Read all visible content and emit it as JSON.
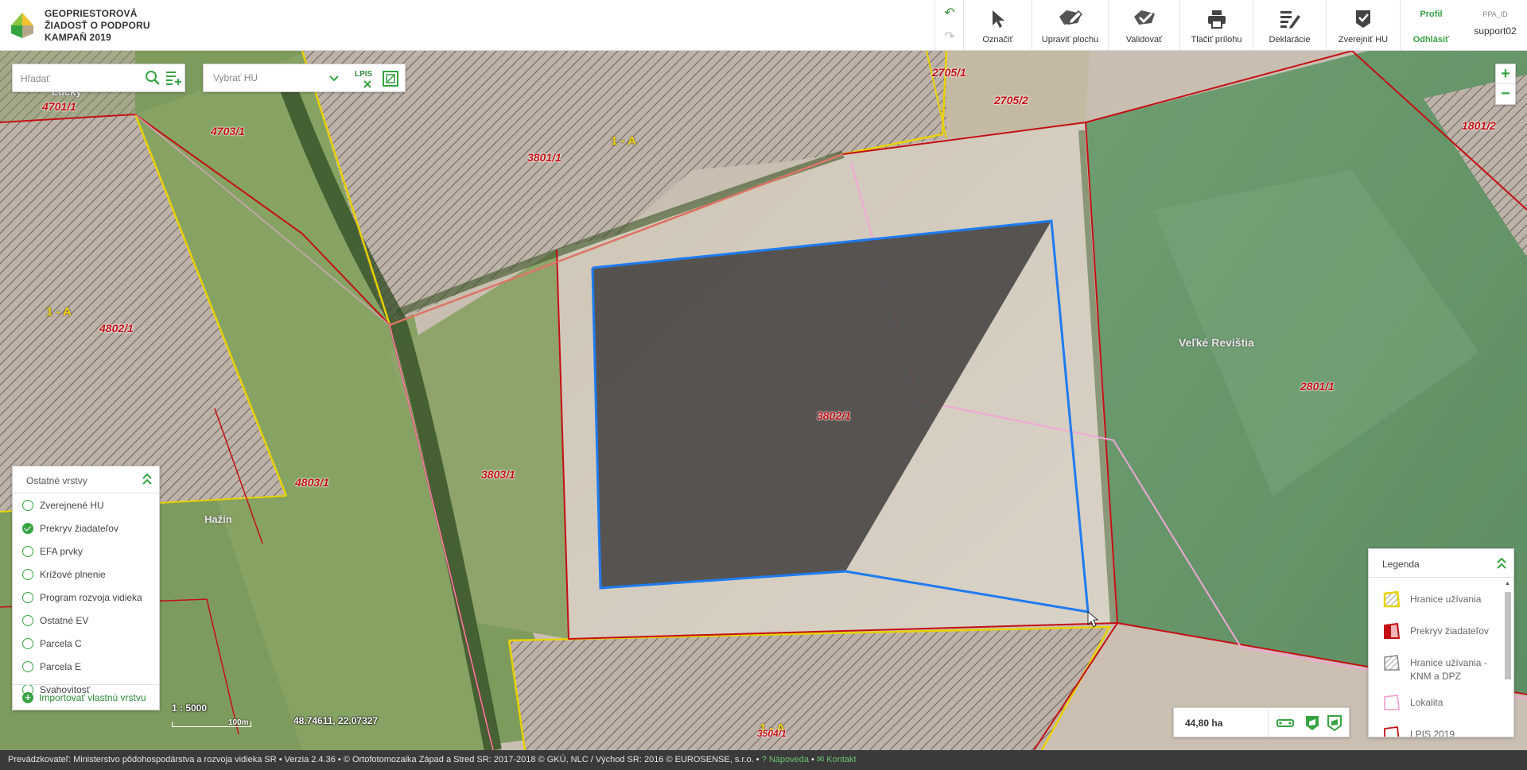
{
  "header": {
    "title_lines": [
      "GEOPRIESTOROVÁ",
      "ŽIADOSŤ O PODPORU",
      "KAMPAŇ 2019"
    ],
    "tools": [
      {
        "label": "Označiť",
        "icon": "cursor-icon"
      },
      {
        "label": "Upraviť plochu",
        "icon": "edit-area-icon"
      },
      {
        "label": "Validovať",
        "icon": "validate-icon"
      },
      {
        "label": "Tlačiť prílohu",
        "icon": "print-icon"
      },
      {
        "label": "Deklarácie",
        "icon": "declarations-icon"
      },
      {
        "label": "Zverejniť HU",
        "icon": "publish-icon"
      }
    ],
    "profile_label": "Profil",
    "logout_label": "Odhlásiť",
    "ppa_id_label": "PPA_ID",
    "user": "support02"
  },
  "search": {
    "placeholder": "Hľadať",
    "hu_placeholder": "Vybrať HU",
    "lpis_label": "LPIS"
  },
  "map": {
    "labels": {
      "p4701": "4701/1",
      "p4703": "4703/1",
      "lucky": "Lúcky",
      "p3801": "3801/1",
      "code1a_top": "1 - A",
      "p2705_1": "2705/1",
      "p2705_2": "2705/2",
      "p1801": "1801/2",
      "code1a_left": "1 - A",
      "p4802": "4802/1",
      "p3802": "3802/1",
      "velke": "Veľké Revištia",
      "p2801": "2801/1",
      "p4803": "4803/1",
      "p3803": "3803/1",
      "hazin": "Hažín",
      "code1a_bottom": "1 - A",
      "p3504": "3504/1"
    },
    "scale": "1 : 5000",
    "scale_bar": "100m",
    "coordinates": "48.74611, 22.07327",
    "area": "44,80 ha"
  },
  "layers_panel": {
    "title": "Ostatné vrstvy",
    "items": [
      {
        "label": "Zverejnené HU",
        "checked": false
      },
      {
        "label": "Prekryv žiadateľov",
        "checked": true
      },
      {
        "label": "EFA prvky",
        "checked": false
      },
      {
        "label": "Krížové plnenie",
        "checked": false
      },
      {
        "label": "Program rozvoja vidieka",
        "checked": false
      },
      {
        "label": "Ostatné EV",
        "checked": false
      },
      {
        "label": "Parcela C",
        "checked": false
      },
      {
        "label": "Parcela E",
        "checked": false
      },
      {
        "label": "Svahovitosť",
        "checked": false
      }
    ],
    "import_label": "Importovať vlastnú vrstvu"
  },
  "legend": {
    "title": "Legenda",
    "items": [
      {
        "label": "Hranice užívania",
        "color": "#e8d200"
      },
      {
        "label": "Prekryv žiadateľov",
        "color": "#c40f14"
      },
      {
        "label": "Hranice užívania - KNM a DPZ",
        "color": "#555555"
      },
      {
        "label": "Lokalita",
        "color": "#f1a7d6"
      },
      {
        "label": "LPIS 2019",
        "color": "#c40f14"
      }
    ]
  },
  "footer": {
    "text": "Prevádzkovateľ: Ministerstvo pôdohospodárstva a rozvoja vidieka SR • Verzia 2.4.36 • © Ortofotomozaika Západ a Stred SR: 2017-2018 © GKÚ, NLC / Východ SR: 2016 © EUROSENSE, s.r.o. •",
    "help": "Nápoveda",
    "contact": "Kontakt"
  },
  "colors": {
    "accent": "#36a343",
    "parcel_border": "#c40f14",
    "usage_border": "#e8d200",
    "selection": "#1e7bf0"
  }
}
